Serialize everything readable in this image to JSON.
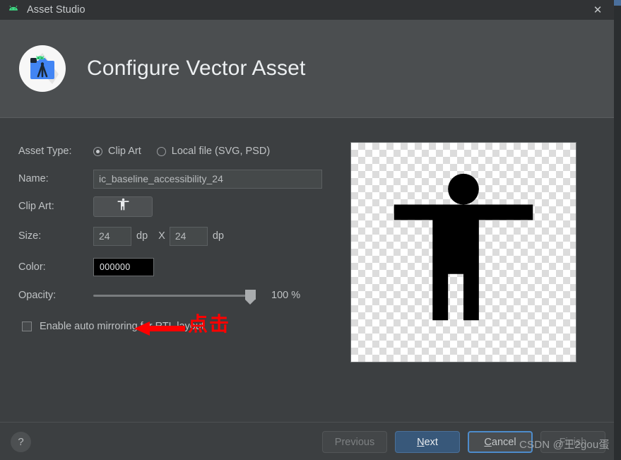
{
  "window": {
    "titlebar": {
      "app_icon": "android-robot-icon",
      "title": "Asset Studio",
      "close_label": "✕"
    },
    "banner": {
      "logo": "android-studio-asset-icon",
      "title": "Configure Vector Asset"
    }
  },
  "form": {
    "asset_type": {
      "label": "Asset Type:",
      "options": [
        {
          "label": "Clip Art",
          "selected": true
        },
        {
          "label": "Local file (SVG, PSD)",
          "selected": false
        }
      ]
    },
    "name": {
      "label": "Name:",
      "value": "ic_baseline_accessibility_24"
    },
    "clip_art": {
      "label": "Clip Art:",
      "icon": "accessibility-icon"
    },
    "size": {
      "label": "Size:",
      "width_value": "24",
      "height_value": "24",
      "unit": "dp",
      "separator": "X"
    },
    "color": {
      "label": "Color:",
      "value": "000000",
      "hex": "#000000"
    },
    "opacity": {
      "label": "Opacity:",
      "value": "100 %",
      "percent": 100
    },
    "rtl": {
      "label": "Enable auto mirroring for RTL layout",
      "checked": false
    }
  },
  "annotation": {
    "text": "点击",
    "color": "#ff0000",
    "arrow": "left-arrow-icon"
  },
  "preview": {
    "icon": "accessibility-icon",
    "icon_color": "#000000",
    "background": "transparency-checkerboard"
  },
  "footer": {
    "help_label": "?",
    "buttons": [
      {
        "label": "Previous",
        "state": "disabled"
      },
      {
        "label": "Next",
        "state": "primary",
        "mnemonic": "N"
      },
      {
        "label": "Cancel",
        "state": "focused",
        "mnemonic": "C"
      },
      {
        "label": "Finish",
        "state": "disabled"
      }
    ]
  },
  "watermark": {
    "text": "CSDN @王2gou蛋"
  }
}
